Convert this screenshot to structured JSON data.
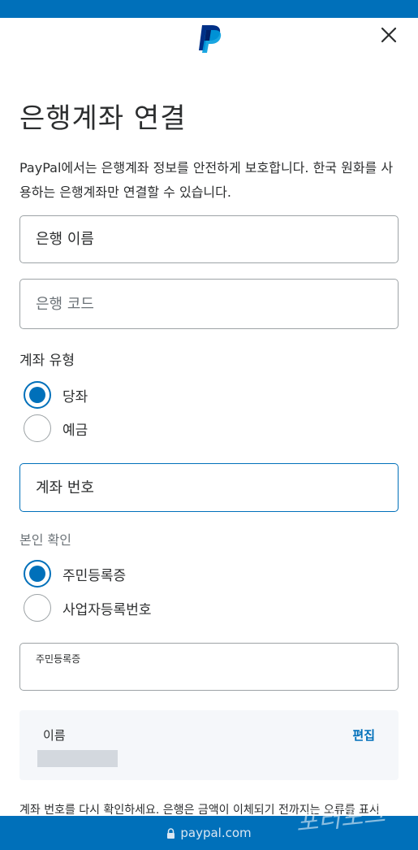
{
  "header": {
    "logo_icon": "paypal-logo",
    "close_icon": "close-icon"
  },
  "title": "은행계좌 연결",
  "description": "PayPal에서는 은행계좌 정보를 안전하게 보호합니다. 한국 원화를 사용하는 은행계좌만 연결할 수 있습니다.",
  "fields": {
    "bank_name_placeholder": "은행 이름",
    "bank_code_placeholder": "은행 코드",
    "account_number_placeholder": "계좌 번호"
  },
  "account_type": {
    "label": "계좌 유형",
    "options": [
      "당좌",
      "예금"
    ],
    "selected": "당좌"
  },
  "identity": {
    "label": "본인 확인",
    "options": [
      "주민등록증",
      "사업자등록번호"
    ],
    "selected": "주민등록증",
    "id_field_label": "주민등록증"
  },
  "name_box": {
    "label": "이름",
    "edit_label": "편집"
  },
  "note": "계좌 번호를 다시 확인하세요. 은행은 금액이 이체되기 전까지는 오류를 표시",
  "footer": {
    "domain": "paypal.com",
    "lock_icon": "lock-icon"
  },
  "watermark": "포러포크",
  "colors": {
    "brand_blue": "#0070ba",
    "border_gray": "#9da3a6",
    "text": "#2c2e2f"
  }
}
